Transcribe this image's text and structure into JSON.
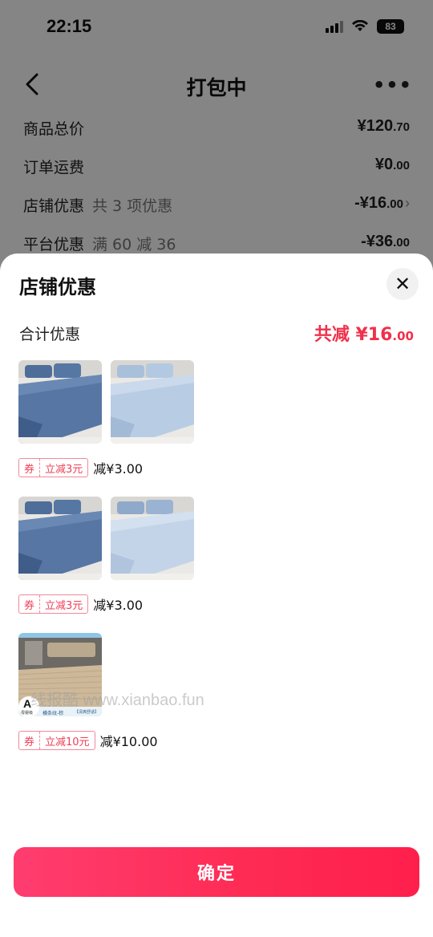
{
  "status_bar": {
    "time": "22:15",
    "battery": "83"
  },
  "nav": {
    "title": "打包中",
    "more": "•••"
  },
  "summary": {
    "rows": [
      {
        "label": "商品总价",
        "sub": "",
        "amount_main": "¥120",
        "amount_dec": ".70"
      },
      {
        "label": "订单运费",
        "sub": "",
        "amount_main": "¥0",
        "amount_dec": ".00"
      },
      {
        "label": "店铺优惠",
        "sub": "共 3 项优惠",
        "amount_main": "-¥16",
        "amount_dec": ".00"
      },
      {
        "label": "平台优惠",
        "sub": "满 60 减 36",
        "amount_main": "-¥36",
        "amount_dec": ".00"
      }
    ]
  },
  "sheet": {
    "title": "店铺优惠",
    "total_label": "合计优惠",
    "total_prefix": "共减 ¥",
    "total_main": "16",
    "total_dec": ".00",
    "groups": [
      {
        "coupon_tag": "券",
        "coupon_text": "立减3元",
        "saving": "减¥3.00"
      },
      {
        "coupon_tag": "券",
        "coupon_text": "立减3元",
        "saving": "减¥3.00"
      },
      {
        "coupon_tag": "券",
        "coupon_text": "立减10元",
        "saving": "减¥10.00",
        "thumb_caption": "横条纹-棕",
        "thumb_caption2": "【清爽舒适】",
        "badge_letter": "A",
        "badge_text": "母婴级"
      }
    ],
    "confirm_label": "确定"
  },
  "watermark": "线报酷 www.xianbao.fun",
  "colors": {
    "accent": "#fe2c55",
    "discount_red": "#f0304b",
    "coupon_border": "#f18a97"
  }
}
